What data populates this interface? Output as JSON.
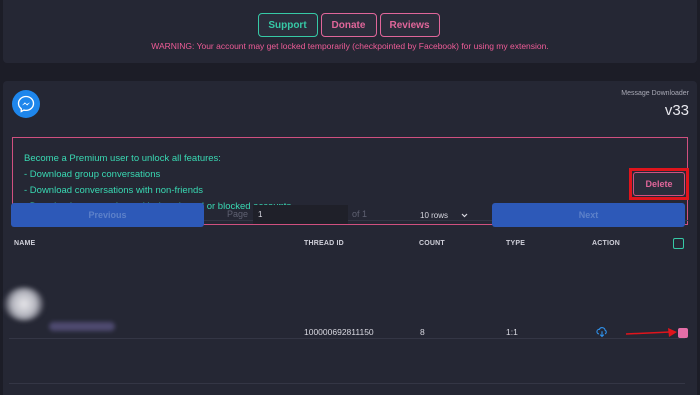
{
  "header": {
    "buttons": {
      "support": "Support",
      "donate": "Donate",
      "reviews": "Reviews"
    },
    "warning": "WARNING: Your account may get locked temporarily (checkpointed by Facebook) for using my extension."
  },
  "app": {
    "name": "Message Downloader",
    "version": "v33",
    "logo_icon": "messenger-icon"
  },
  "premium": {
    "lines": [
      "Become a Premium user to unlock all features:",
      "- Download group conversations",
      "- Download conversations with non-friends",
      "- Download conversations with deactivated or blocked accounts"
    ]
  },
  "toolbar": {
    "delete_label": "Delete"
  },
  "pagination": {
    "previous_label": "Previous",
    "page_label": "Page",
    "page_value": "1",
    "of_label": "of 1",
    "rows_value": "10 rows",
    "next_label": "Next"
  },
  "table": {
    "headers": {
      "name": "NAME",
      "thread_id": "THREAD ID",
      "count": "COUNT",
      "type": "TYPE",
      "action": "ACTION"
    },
    "rows": [
      {
        "thread_id": "100000692811150",
        "count": "8",
        "type": "1:1",
        "action_icon": "cloud-download-icon",
        "selected": true
      }
    ]
  },
  "colors": {
    "background": "#1c1d27",
    "panel": "#252734",
    "accent_teal": "#36c9a6",
    "accent_pink": "#e0669a",
    "primary_blue": "#2d59b8",
    "highlight_red": "#e0141c"
  }
}
